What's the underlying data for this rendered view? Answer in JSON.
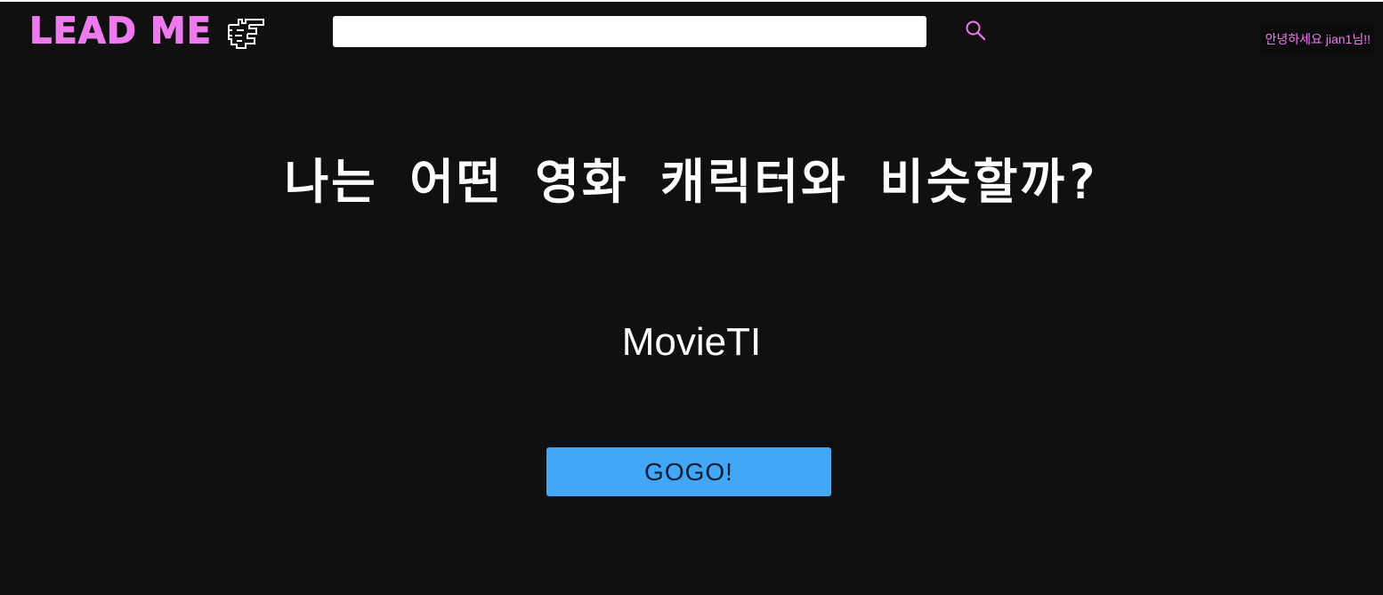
{
  "header": {
    "logo_text": "LEAD ME",
    "logo_icon": "pointing-hand-icon",
    "search": {
      "value": "",
      "placeholder": ""
    },
    "search_icon": "search-icon",
    "greeting": "안녕하세요 jian1님!!"
  },
  "main": {
    "title": "나는 어떤 영화 캐릭터와 비슷할까?",
    "subtitle": "MovieTI",
    "button_label": "GOGO!"
  },
  "colors": {
    "background": "#101010",
    "accent_pink": "#ee7bee",
    "button_blue": "#43a6f7",
    "text": "#ffffff"
  }
}
